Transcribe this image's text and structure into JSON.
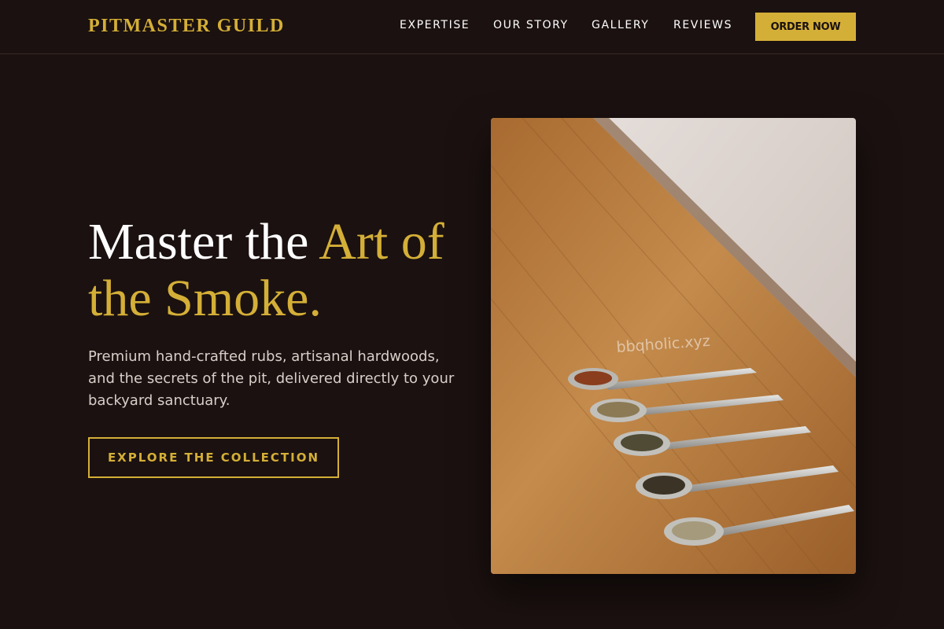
{
  "brand": {
    "name": "PITMASTER GUILD"
  },
  "nav": {
    "links": [
      "EXPERTISE",
      "OUR STORY",
      "GALLERY",
      "REVIEWS"
    ],
    "cta": "ORDER NOW"
  },
  "hero": {
    "headline_part1": "Master the ",
    "headline_part2": "Art of the Smoke.",
    "subtext": "Premium hand-crafted rubs, artisanal hardwoods, and the secrets of the pit, delivered directly to your backyard sanctuary.",
    "cta": "EXPLORE THE COLLECTION"
  },
  "image": {
    "subject": "spice-spoons-on-wooden-board",
    "watermark": "bbqholic.xyz"
  },
  "colors": {
    "background": "#1b1110",
    "accent": "#d4af37",
    "text": "#ffffff",
    "muted_text": "#d9cfc9"
  }
}
